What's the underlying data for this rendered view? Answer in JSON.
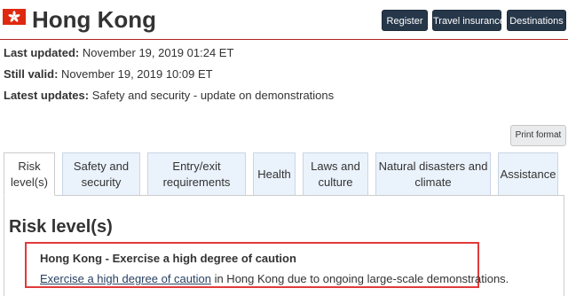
{
  "header": {
    "country": "Hong Kong",
    "flag_icon": "hong-kong-flag-icon",
    "buttons": {
      "register": "Register",
      "travel_insurance": "Travel insurance",
      "destinations": "Destinations"
    }
  },
  "meta": {
    "last_updated_label": "Last updated:",
    "last_updated_value": "November 19, 2019 01:24 ET",
    "still_valid_label": "Still valid:",
    "still_valid_value": "November 19, 2019 10:09 ET",
    "latest_updates_label": "Latest updates:",
    "latest_updates_value": "Safety and security - update on demonstrations"
  },
  "print_button": "Print format",
  "tabs": [
    {
      "line1": "Risk",
      "line2": "level(s)",
      "active": true
    },
    {
      "line1": "Safety and",
      "line2": "security",
      "active": false
    },
    {
      "line1": "Entry/exit",
      "line2": "requirements",
      "active": false
    },
    {
      "line1": "Health",
      "line2": "",
      "active": false
    },
    {
      "line1": "Laws and",
      "line2": "culture",
      "active": false
    },
    {
      "line1": "Natural disasters and",
      "line2": "climate",
      "active": false
    },
    {
      "line1": "Assistance",
      "line2": "",
      "active": false
    }
  ],
  "panel": {
    "title": "Risk level(s)",
    "risk_heading": "Hong Kong - Exercise a high degree of caution",
    "risk_link": "Exercise a high degree of caution",
    "risk_rest": " in Hong Kong due to ongoing large-scale demonstrations."
  },
  "colors": {
    "header_rule": "#b22222",
    "button_bg": "#26374a",
    "tab_bg": "#eaf2fb",
    "highlight_border": "#e23a3a"
  }
}
